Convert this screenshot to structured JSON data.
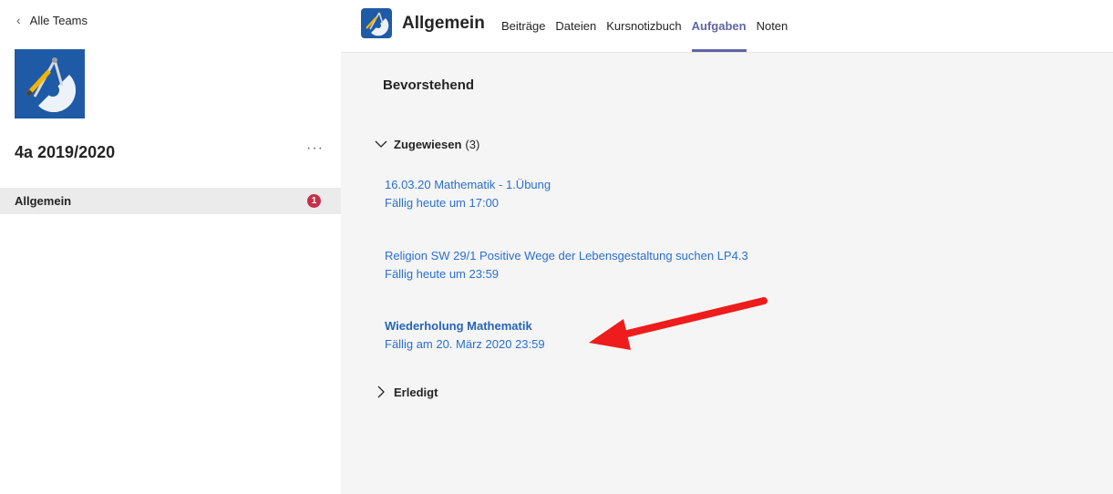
{
  "team_pane": {
    "back_label": "Alle Teams",
    "team_name": "4a 2019/2020",
    "more_label": "···",
    "channel": {
      "label": "Allgemein",
      "badge": "1"
    }
  },
  "header": {
    "channel_title": "Allgemein",
    "tabs": [
      {
        "label": "Beiträge",
        "active": false
      },
      {
        "label": "Dateien",
        "active": false
      },
      {
        "label": "Kursnotizbuch",
        "active": false
      },
      {
        "label": "Aufgaben",
        "active": true
      },
      {
        "label": "Noten",
        "active": false
      }
    ]
  },
  "assignments": {
    "section_title": "Bevorstehend",
    "assigned_group": {
      "label": "Zugewiesen",
      "count": "(3)"
    },
    "items": [
      {
        "title": "16.03.20 Mathematik - 1.Übung",
        "due": "Fällig heute um 17:00"
      },
      {
        "title": "Religion SW 29/1 Positive Wege der Lebensgestaltung suchen LP4.3",
        "due": "Fällig heute um 23:59"
      },
      {
        "title": "Wiederholung Mathematik",
        "due": "Fällig am 20. März 2020 23:59"
      }
    ],
    "done_group": {
      "label": "Erledigt"
    }
  },
  "colors": {
    "accent": "#6264a7",
    "link": "#2a6fd1",
    "badge": "#c4314b",
    "logo_bg": "#1f5aa6",
    "annotation_arrow": "#ee1c1c"
  },
  "icons": {
    "back": "chevron-left-icon",
    "expanded": "chevron-down-icon",
    "collapsed": "chevron-right-icon",
    "logo": "geometry-tools-logo"
  }
}
